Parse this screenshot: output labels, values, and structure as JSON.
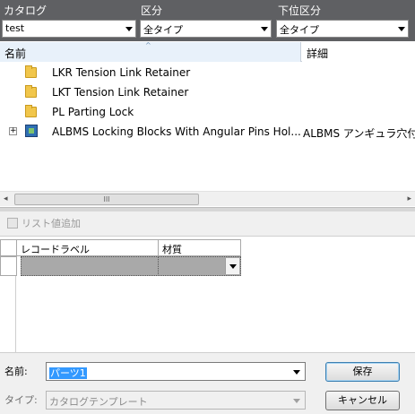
{
  "filters": {
    "catalog": {
      "label": "カタログ",
      "value": "test"
    },
    "category": {
      "label": "区分",
      "value": "全タイプ"
    },
    "subcategory": {
      "label": "下位区分",
      "value": "全タイプ"
    }
  },
  "list": {
    "columns": {
      "name": "名前",
      "detail": "詳細"
    },
    "sort_glyph": "^",
    "items": [
      {
        "type": "folder",
        "label": "LKR Tension Link Retainer",
        "detail": ""
      },
      {
        "type": "folder",
        "label": "LKT Tension Link Retainer",
        "detail": ""
      },
      {
        "type": "folder",
        "label": "PL Parting Lock",
        "detail": ""
      },
      {
        "type": "part",
        "label": "ALBMS Locking Blocks With Angular Pins Hol...",
        "detail": "ALBMS アンギュラ穴付ロック"
      }
    ]
  },
  "scrollbar": {
    "left_arrow": "◂",
    "right_arrow": "▸",
    "thumb_grip": "III"
  },
  "toolbar": {
    "add_value_label": "リスト値追加"
  },
  "grid": {
    "columns": [
      "レコードラベル",
      "材質"
    ],
    "rows": [
      [
        "",
        ""
      ]
    ]
  },
  "footer": {
    "name_label": "名前:",
    "name_value": "パーツ1",
    "type_label": "タイプ:",
    "type_value": "カタログテンプレート",
    "save_label": "保存",
    "cancel_label": "キャンセル"
  },
  "colors": {
    "filter_bar": "#5f6063",
    "selected_header": "#e8f1fa",
    "selection": "#3399ff"
  }
}
